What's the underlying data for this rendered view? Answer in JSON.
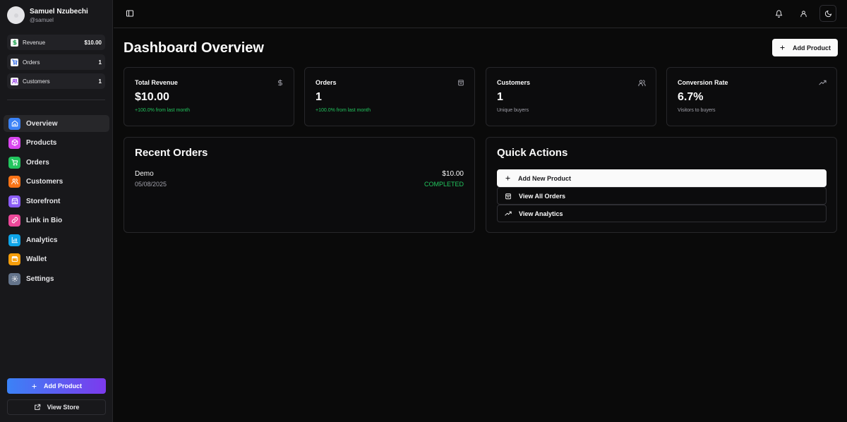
{
  "colors": {
    "nav_overview": "#3b82f6",
    "nav_products": "#d946ef",
    "nav_orders": "#22c55e",
    "nav_customers": "#f97316",
    "nav_storefront": "#8b5cf6",
    "nav_link_in_bio": "#ec4899",
    "nav_analytics": "#0ea5e9",
    "nav_wallet": "#f59e0b",
    "nav_settings": "#64748b",
    "success": "#22c55e"
  },
  "user": {
    "name": "Samuel Nzubechi",
    "handle": "@samuel"
  },
  "sidebar_stats": [
    {
      "label": "Revenue",
      "value": "$10.00",
      "icon": "dollar-icon"
    },
    {
      "label": "Orders",
      "value": "1",
      "icon": "cart-icon"
    },
    {
      "label": "Customers",
      "value": "1",
      "icon": "users-icon"
    }
  ],
  "nav": [
    {
      "label": "Overview",
      "icon": "home-icon",
      "active": true
    },
    {
      "label": "Products",
      "icon": "box-icon"
    },
    {
      "label": "Orders",
      "icon": "cart-icon"
    },
    {
      "label": "Customers",
      "icon": "users-icon"
    },
    {
      "label": "Storefront",
      "icon": "store-icon"
    },
    {
      "label": "Link in Bio",
      "icon": "link-icon"
    },
    {
      "label": "Analytics",
      "icon": "bar-chart-icon"
    },
    {
      "label": "Wallet",
      "icon": "wallet-icon"
    },
    {
      "label": "Settings",
      "icon": "gear-icon"
    }
  ],
  "sidebar_buttons": {
    "add_product": "Add Product",
    "view_store": "View Store"
  },
  "header": {
    "title": "Dashboard Overview",
    "add_product": "Add Product"
  },
  "kpis": [
    {
      "label": "Total Revenue",
      "value": "$10.00",
      "sub": "+100.0% from last month",
      "icon": "dollar-icon"
    },
    {
      "label": "Orders",
      "value": "1",
      "sub": "+100.0% from last month",
      "icon": "bag-icon"
    },
    {
      "label": "Customers",
      "value": "1",
      "sub": "Unique buyers",
      "icon": "users-icon"
    },
    {
      "label": "Conversion Rate",
      "value": "6.7%",
      "sub": "Visitors to buyers",
      "icon": "trending-up-icon"
    }
  ],
  "recent_orders": {
    "title": "Recent Orders",
    "items": [
      {
        "name": "Demo",
        "date": "05/08/2025",
        "amount": "$10.00",
        "status": "COMPLETED"
      }
    ]
  },
  "quick_actions": {
    "title": "Quick Actions",
    "items": [
      {
        "label": "Add New Product",
        "icon": "plus-icon"
      },
      {
        "label": "View All Orders",
        "icon": "bag-icon"
      },
      {
        "label": "View Analytics",
        "icon": "trending-up-icon"
      }
    ]
  }
}
